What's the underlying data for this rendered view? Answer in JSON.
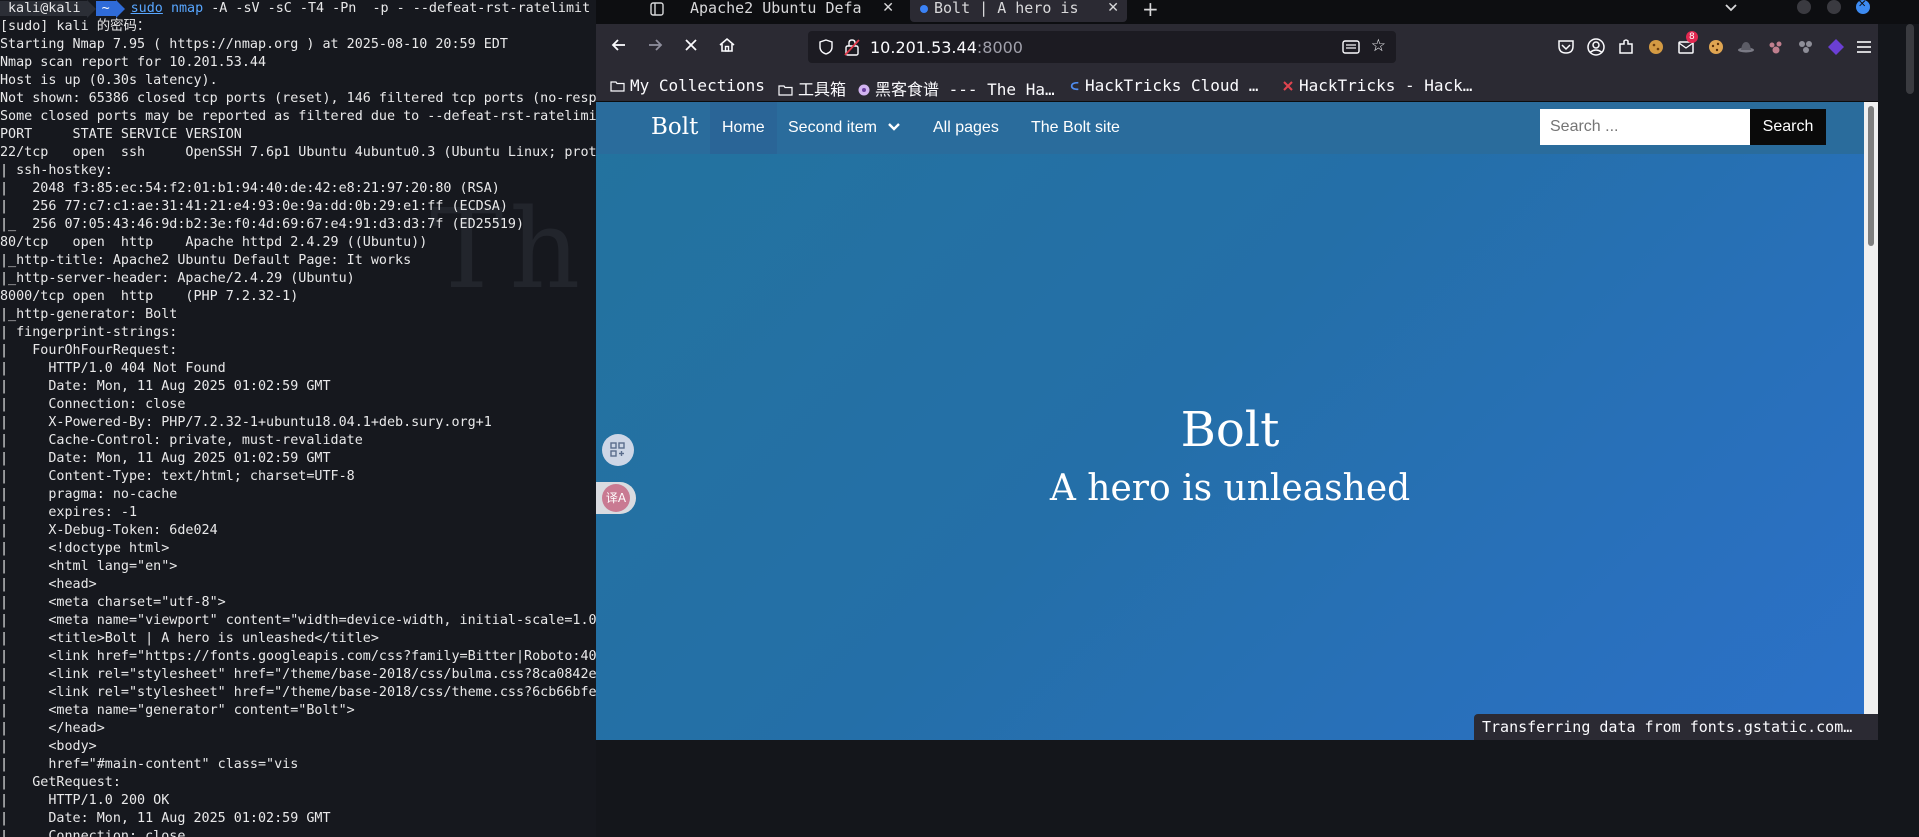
{
  "terminal": {
    "prompt_user": "kali@kali",
    "prompt_dir": "~",
    "cmd_sudo": "sudo",
    "cmd_nmap": "nmap",
    "cmd_args": "-A -sV -sC -T4 -Pn  -p - --defeat-rst-ratelimit",
    "lines": [
      "[sudo] kali 的密码：",
      "Starting Nmap 7.95 ( https://nmap.org ) at 2025-08-10 20:59 EDT",
      "Nmap scan report for 10.201.53.44",
      "Host is up (0.30s latency).",
      "Not shown: 65386 closed tcp ports (reset), 146 filtered tcp ports (no-resp",
      "Some closed ports may be reported as filtered due to --defeat-rst-ratelimi",
      "PORT     STATE SERVICE VERSION",
      "22/tcp   open  ssh     OpenSSH 7.6p1 Ubuntu 4ubuntu0.3 (Ubuntu Linux; prot",
      "| ssh-hostkey:",
      "|   2048 f3:85:ec:54:f2:01:b1:94:40:de:42:e8:21:97:20:80 (RSA)",
      "|   256 77:c7:c1:ae:31:41:21:e4:93:0e:9a:dd:0b:29:e1:ff (ECDSA)",
      "|_  256 07:05:43:46:9d:b2:3e:f0:4d:69:67:e4:91:d3:d3:7f (ED25519)",
      "80/tcp   open  http    Apache httpd 2.4.29 ((Ubuntu))",
      "|_http-title: Apache2 Ubuntu Default Page: It works",
      "|_http-server-header: Apache/2.4.29 (Ubuntu)",
      "8000/tcp open  http    (PHP 7.2.32-1)",
      "|_http-generator: Bolt",
      "| fingerprint-strings:",
      "|   FourOhFourRequest:",
      "|     HTTP/1.0 404 Not Found",
      "|     Date: Mon, 11 Aug 2025 01:02:59 GMT",
      "|     Connection: close",
      "|     X-Powered-By: PHP/7.2.32-1+ubuntu18.04.1+deb.sury.org+1",
      "|     Cache-Control: private, must-revalidate",
      "|     Date: Mon, 11 Aug 2025 01:02:59 GMT",
      "|     Content-Type: text/html; charset=UTF-8",
      "|     pragma: no-cache",
      "|     expires: -1",
      "|     X-Debug-Token: 6de024",
      "|     <!doctype html>",
      "|     <html lang=\"en\">",
      "|     <head>",
      "|     <meta charset=\"utf-8\">",
      "|     <meta name=\"viewport\" content=\"width=device-width, initial-scale=1.0",
      "|     <title>Bolt | A hero is unleashed</title>",
      "|     <link href=\"https://fonts.googleapis.com/css?family=Bitter|Roboto:40",
      "|     <link rel=\"stylesheet\" href=\"/theme/base-2018/css/bulma.css?8ca0842e",
      "|     <link rel=\"stylesheet\" href=\"/theme/base-2018/css/theme.css?6cb66bfe",
      "|     <meta name=\"generator\" content=\"Bolt\">",
      "|     </head>",
      "|     <body>",
      "|     href=\"#main-content\" class=\"vis",
      "|   GetRequest:",
      "|     HTTP/1.0 200 OK",
      "|     Date: Mon, 11 Aug 2025 01:02:59 GMT",
      "|     Connection: close"
    ]
  },
  "tabs": [
    {
      "title": "Apache2 Ubuntu Defa"
    },
    {
      "title": "Bolt | A hero is"
    }
  ],
  "new_tab": "+",
  "address": {
    "host": "10.201.53.44",
    "port": ":8000"
  },
  "toolbar": {
    "notif_badge": "8"
  },
  "bookmarks": [
    {
      "label": "My Collections"
    },
    {
      "label": "工具箱"
    },
    {
      "label": "黑客食谱 --- The Ha…"
    },
    {
      "label": "HackTricks Cloud …"
    },
    {
      "label": "HackTricks - Hack…"
    }
  ],
  "site": {
    "brand": "Bolt",
    "nav": {
      "home": "Home",
      "second": "Second item",
      "allpages": "All pages",
      "boltsite": "The Bolt site"
    },
    "search_placeholder": "Search ...",
    "search_button": "Search",
    "hero_title": "Bolt",
    "hero_subtitle": "A hero is unleashed"
  },
  "status_text": "Transferring data from fonts.gstatic.com…",
  "float_b_label": "译A",
  "colors": {
    "accent": "#2f6bd8",
    "page_gradient_start": "#23739e",
    "page_gradient_end": "#2c71c9"
  }
}
